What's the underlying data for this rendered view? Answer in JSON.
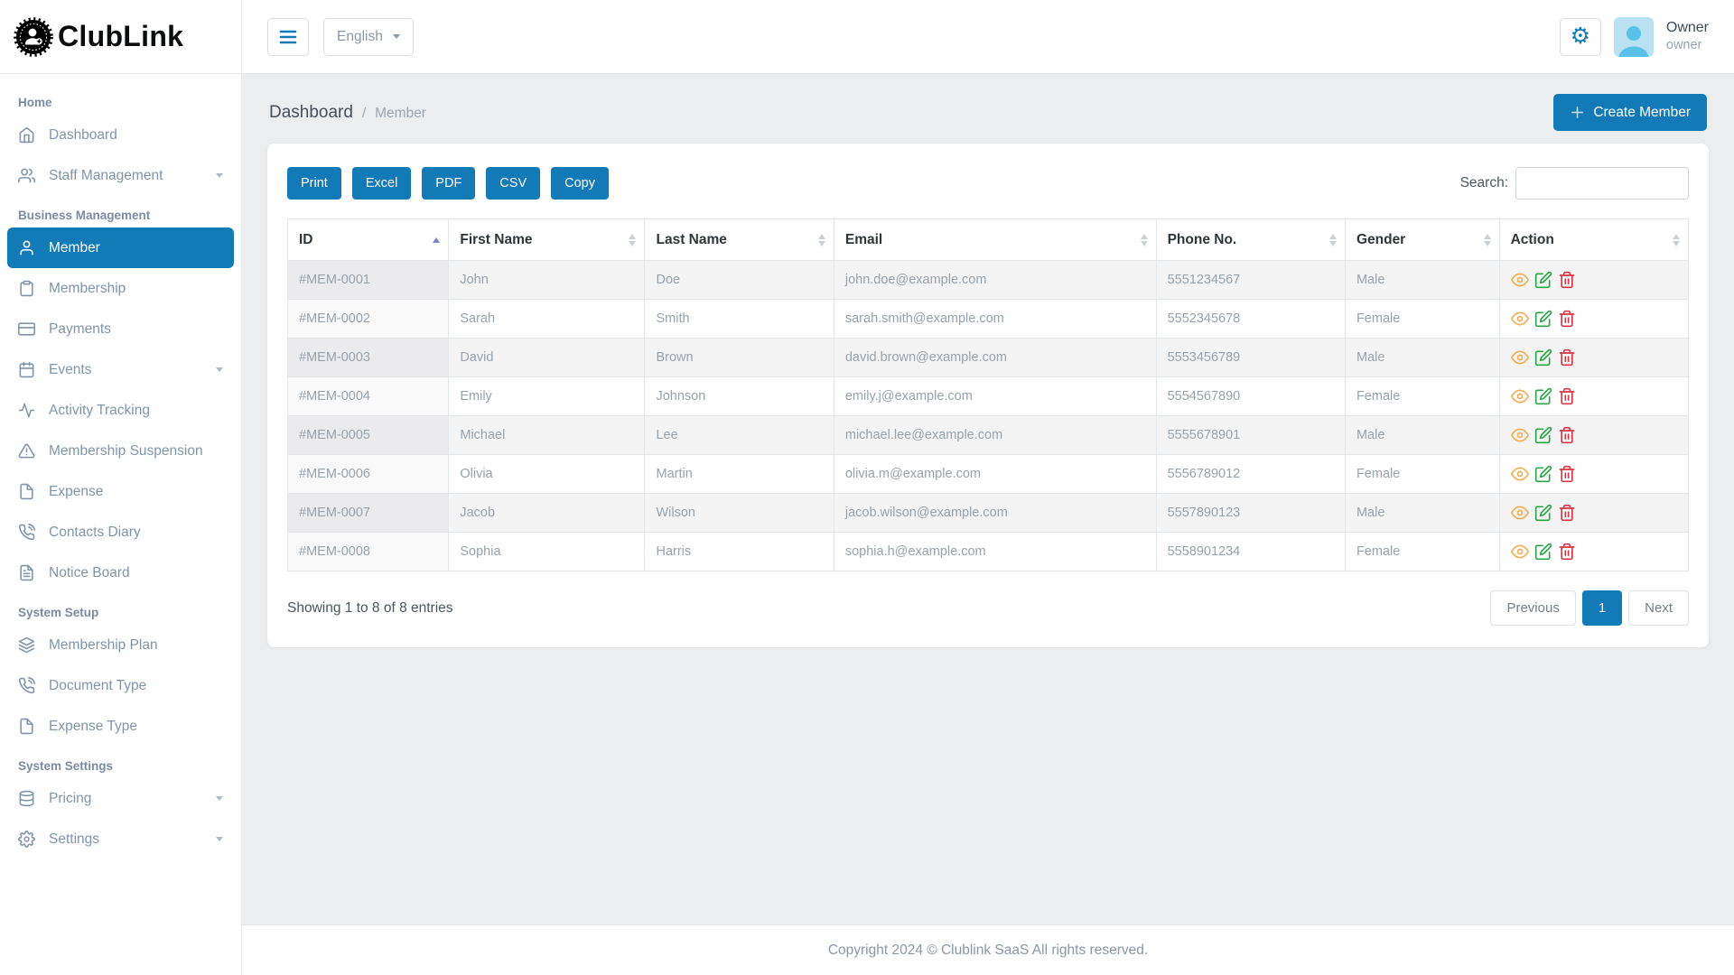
{
  "brand": {
    "name": "ClubLink"
  },
  "topbar": {
    "language": "English",
    "user_name": "Owner",
    "user_role": "owner"
  },
  "breadcrumb": {
    "primary": "Dashboard",
    "separator": "/",
    "current": "Member"
  },
  "create_button_label": "Create Member",
  "sidebar": {
    "sections": [
      {
        "header": "Home",
        "items": [
          {
            "label": "Dashboard",
            "icon": "home",
            "chevron": false,
            "active": false
          },
          {
            "label": "Staff Management",
            "icon": "users",
            "chevron": true,
            "active": false
          }
        ]
      },
      {
        "header": "Business Management",
        "items": [
          {
            "label": "Member",
            "icon": "user",
            "chevron": false,
            "active": true
          },
          {
            "label": "Membership",
            "icon": "clipboard",
            "chevron": false,
            "active": false
          },
          {
            "label": "Payments",
            "icon": "credit-card",
            "chevron": false,
            "active": false
          },
          {
            "label": "Events",
            "icon": "calendar",
            "chevron": true,
            "active": false
          },
          {
            "label": "Activity Tracking",
            "icon": "activity",
            "chevron": false,
            "active": false
          },
          {
            "label": "Membership Suspension",
            "icon": "alert-triangle",
            "chevron": false,
            "active": false
          },
          {
            "label": "Expense",
            "icon": "file",
            "chevron": false,
            "active": false
          },
          {
            "label": "Contacts Diary",
            "icon": "phone-call",
            "chevron": false,
            "active": false
          },
          {
            "label": "Notice Board",
            "icon": "file-text",
            "chevron": false,
            "active": false
          }
        ]
      },
      {
        "header": "System Setup",
        "items": [
          {
            "label": "Membership Plan",
            "icon": "layers",
            "chevron": false,
            "active": false
          },
          {
            "label": "Document Type",
            "icon": "phone-call",
            "chevron": false,
            "active": false
          },
          {
            "label": "Expense Type",
            "icon": "file",
            "chevron": false,
            "active": false
          }
        ]
      },
      {
        "header": "System Settings",
        "items": [
          {
            "label": "Pricing",
            "icon": "database",
            "chevron": true,
            "active": false
          },
          {
            "label": "Settings",
            "icon": "settings",
            "chevron": true,
            "active": false
          }
        ]
      }
    ]
  },
  "toolbar": {
    "export_buttons": [
      "Print",
      "Excel",
      "PDF",
      "CSV",
      "Copy"
    ],
    "search_label": "Search:"
  },
  "table": {
    "columns": [
      {
        "label": "ID",
        "sort": "asc",
        "width": "11.5%"
      },
      {
        "label": "First Name",
        "sort": "both",
        "width": "14%"
      },
      {
        "label": "Last Name",
        "sort": "both",
        "width": "13.5%"
      },
      {
        "label": "Email",
        "sort": "both",
        "width": "23%"
      },
      {
        "label": "Phone No.",
        "sort": "both",
        "width": "13.5%"
      },
      {
        "label": "Gender",
        "sort": "both",
        "width": "11%"
      },
      {
        "label": "Action",
        "sort": "both",
        "width": "13.5%"
      }
    ],
    "rows": [
      {
        "id": "#MEM-0001",
        "first_name": "John",
        "last_name": "Doe",
        "email": "john.doe@example.com",
        "phone": "5551234567",
        "gender": "Male"
      },
      {
        "id": "#MEM-0002",
        "first_name": "Sarah",
        "last_name": "Smith",
        "email": "sarah.smith@example.com",
        "phone": "5552345678",
        "gender": "Female"
      },
      {
        "id": "#MEM-0003",
        "first_name": "David",
        "last_name": "Brown",
        "email": "david.brown@example.com",
        "phone": "5553456789",
        "gender": "Male"
      },
      {
        "id": "#MEM-0004",
        "first_name": "Emily",
        "last_name": "Johnson",
        "email": "emily.j@example.com",
        "phone": "5554567890",
        "gender": "Female"
      },
      {
        "id": "#MEM-0005",
        "first_name": "Michael",
        "last_name": "Lee",
        "email": "michael.lee@example.com",
        "phone": "5555678901",
        "gender": "Male"
      },
      {
        "id": "#MEM-0006",
        "first_name": "Olivia",
        "last_name": "Martin",
        "email": "olivia.m@example.com",
        "phone": "5556789012",
        "gender": "Female"
      },
      {
        "id": "#MEM-0007",
        "first_name": "Jacob",
        "last_name": "Wilson",
        "email": "jacob.wilson@example.com",
        "phone": "5557890123",
        "gender": "Male"
      },
      {
        "id": "#MEM-0008",
        "first_name": "Sophia",
        "last_name": "Harris",
        "email": "sophia.h@example.com",
        "phone": "5558901234",
        "gender": "Female"
      }
    ],
    "action_icons": [
      "view-icon",
      "edit-icon",
      "delete-icon"
    ]
  },
  "table_info": "Showing 1 to 8 of 8 entries",
  "pagination": {
    "previous": "Previous",
    "page": "1",
    "next": "Next"
  },
  "footer": {
    "copyright": "Copyright 2024 © Clublink SaaS All rights reserved."
  },
  "colors": {
    "primary": "#137ab8",
    "view_icon": "#f6ad52",
    "edit_icon": "#28a745",
    "delete_icon": "#dc3545",
    "sort_active": "#7b82d9"
  }
}
